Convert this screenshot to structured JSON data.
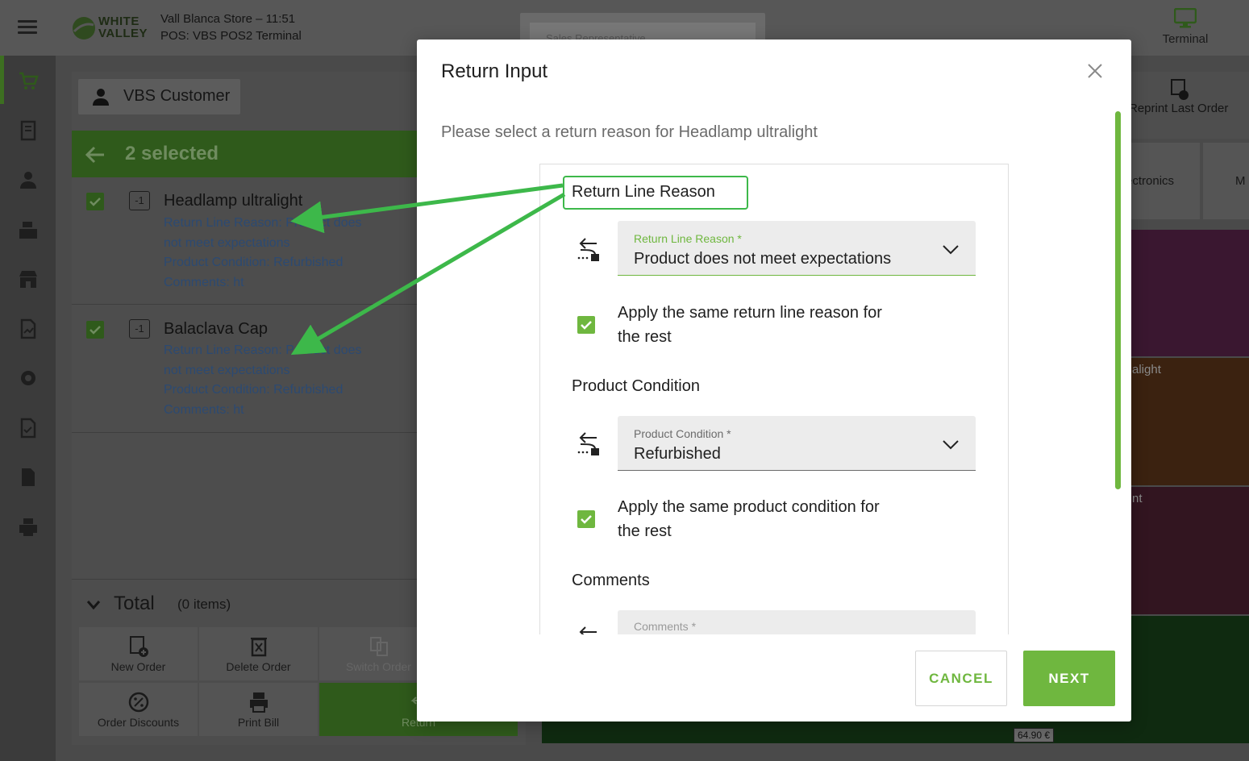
{
  "header": {
    "logo_text": "WHITE VALLEY",
    "store_line": "Vall Blanca Store – 11:51",
    "pos_line": "POS: VBS POS2 Terminal",
    "sales_rep_placeholder": "Sales Representative",
    "terminal_label": "Terminal"
  },
  "nav": {
    "icons": [
      "cart-icon",
      "receipt-icon",
      "customer-icon",
      "cash-register-icon",
      "store-icon",
      "report-icon",
      "settings-icon",
      "document-check-icon",
      "file-icon",
      "printer-icon"
    ]
  },
  "order": {
    "customer": "VBS Customer",
    "selected_label": "2 selected",
    "lines": [
      {
        "qty": "-1",
        "name": "Headlamp ultralight",
        "reason": "Return Line Reason: Product does not meet expectations",
        "condition": "Product Condition: Refurbished",
        "comments": "Comments: ht"
      },
      {
        "qty": "-1",
        "name": "Balaclava Cap",
        "reason": "Return Line Reason: Product does not meet expectations",
        "condition": "Product Condition: Refurbished",
        "comments": "Comments: ht"
      }
    ],
    "total_label": "Total",
    "total_count": "(0 items)",
    "actions": {
      "new_order": "New Order",
      "delete_order": "Delete Order",
      "switch_order": "Switch Order",
      "order_discounts": "Order Discounts",
      "print_bill": "Print Bill",
      "return": "Return"
    }
  },
  "background": {
    "reprint_label": "Reprint Last Order",
    "category_partial": "ectronics",
    "category_partial2": "M",
    "product_partial1": "alight",
    "product_partial2": "nt",
    "price_tag": "64.90 €"
  },
  "modal": {
    "title": "Return Input",
    "subtitle": "Please select a return reason for Headlamp ultralight",
    "return_reason_section": "Return Line Reason",
    "return_reason_field_label": "Return Line Reason *",
    "return_reason_value": "Product does not meet expectations",
    "apply_reason_label": "Apply the same return line reason for the rest",
    "condition_section": "Product Condition",
    "condition_field_label": "Product Condition *",
    "condition_value": "Refurbished",
    "apply_condition_label": "Apply the same product condition for the rest",
    "comments_section": "Comments",
    "comments_field_label": "Comments *",
    "cancel_label": "CANCEL",
    "next_label": "NEXT"
  },
  "colors": {
    "accent": "#6fb73f",
    "annotation": "#3db84a",
    "link_blue": "#2c4a72"
  }
}
